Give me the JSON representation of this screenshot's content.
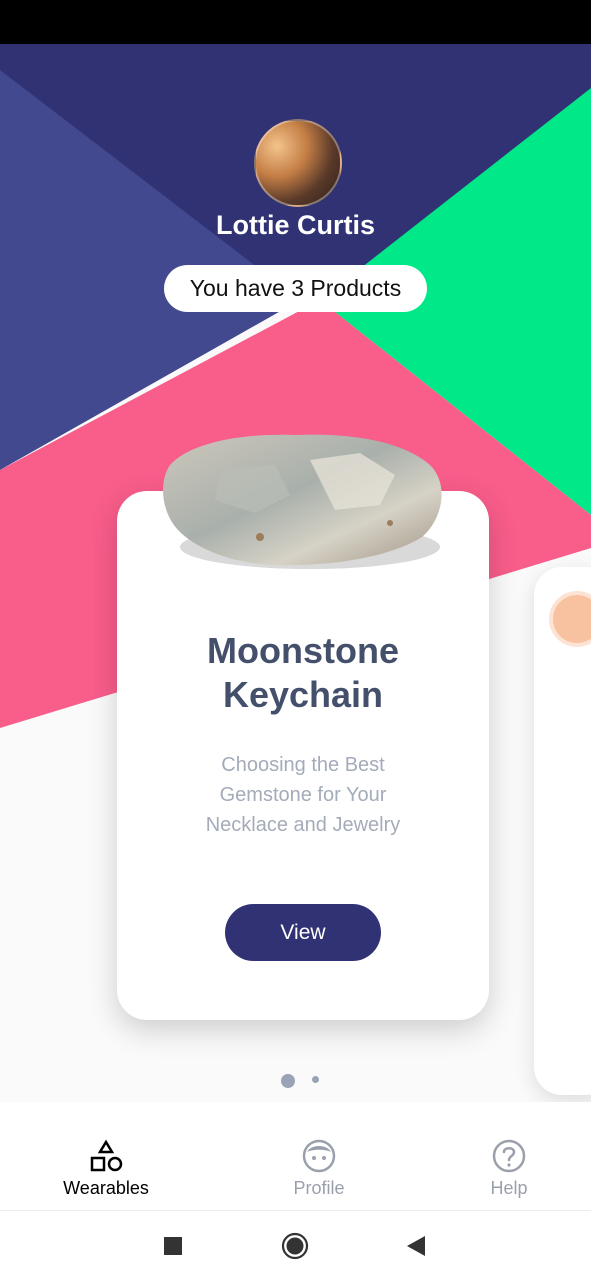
{
  "profile": {
    "name": "Lottie Curtis",
    "products_text": "You have 3 Products"
  },
  "card": {
    "title_lines": [
      "Moonstone",
      "Keychain"
    ],
    "description_lines": [
      "Choosing the Best",
      "Gemstone for Your",
      "Necklace and Jewelry"
    ],
    "button_label": "View"
  },
  "pagination": {
    "total_pages": 2,
    "active_index": 0
  },
  "bottom_nav": [
    {
      "label": "Wearables",
      "icon": "shapes-icon",
      "active": true
    },
    {
      "label": "Profile",
      "icon": "face-icon",
      "active": false
    },
    {
      "label": "Help",
      "icon": "help-circle-icon",
      "active": false
    }
  ],
  "system_nav": [
    "recent-apps-icon",
    "home-icon",
    "back-icon"
  ],
  "colors": {
    "navy": "#303274",
    "indigo": "#43498f",
    "green": "#00e887",
    "pink": "#f95d8a",
    "title_text": "#44506b",
    "muted_text": "#a4abb9"
  }
}
